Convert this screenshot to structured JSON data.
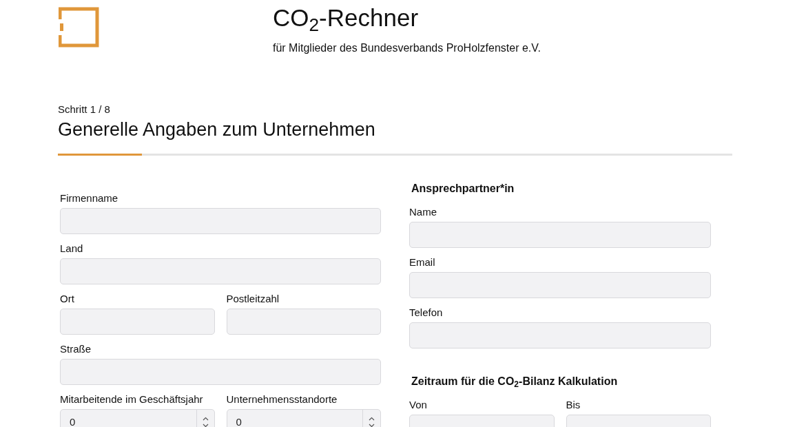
{
  "header": {
    "title": "CO$_{2}$-Rechner",
    "subtitle": "für Mitglieder des Bundesverbands ProHolzfenster e.V."
  },
  "step": {
    "label": "Schritt 1 / 8",
    "title": "Generelle Angaben zum Unternehmen",
    "level": 0.125
  },
  "company": {
    "rows": [
      [
        {
          "label": "Firmenname",
          "kind": "text"
        }
      ],
      [
        {
          "label": "Land",
          "kind": "text"
        }
      ],
      [
        {
          "label": "Ort",
          "kind": "text"
        },
        {
          "label": "Postleitzahl",
          "kind": "text"
        }
      ],
      [
        {
          "label": "Straße",
          "kind": "text"
        }
      ],
      [
        {
          "label": "Mitarbeitende im Geschäftsjahr",
          "kind": "number",
          "value": "0"
        },
        {
          "label": "Unternehmensstandorte",
          "kind": "number",
          "value": "0"
        }
      ]
    ]
  },
  "sections": [
    {
      "heading": "Ansprechpartner*in",
      "rows": [
        [
          {
            "label": "Name",
            "kind": "text"
          }
        ],
        [
          {
            "label": "Email",
            "kind": "text"
          }
        ],
        [
          {
            "label": "Telefon",
            "kind": "text"
          }
        ]
      ]
    },
    {
      "heading": "Zeitraum für die CO$_{2}$-Bilanz Kalkulation",
      "rows": [
        [
          {
            "label": "Von",
            "kind": "text"
          },
          {
            "label": "Bis",
            "kind": "text"
          }
        ]
      ]
    }
  ]
}
